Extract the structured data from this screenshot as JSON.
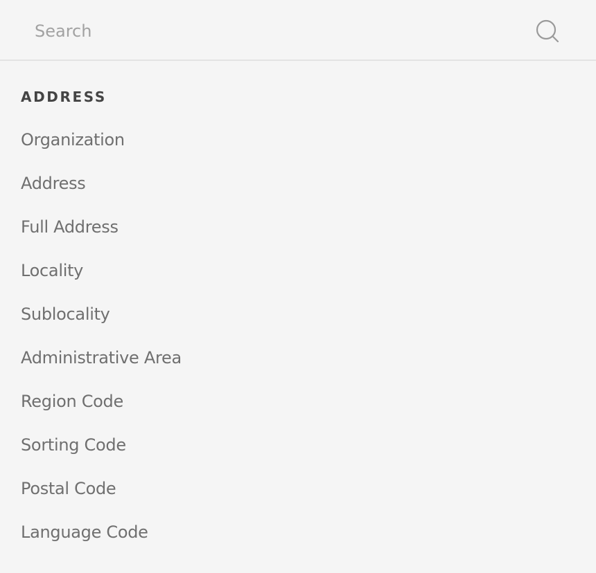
{
  "search": {
    "placeholder": "Search",
    "value": "",
    "icon": "search-icon"
  },
  "section": {
    "title": "ADDRESS",
    "items": [
      {
        "label": "Organization"
      },
      {
        "label": "Address"
      },
      {
        "label": "Full Address"
      },
      {
        "label": "Locality"
      },
      {
        "label": "Sublocality"
      },
      {
        "label": "Administrative Area"
      },
      {
        "label": "Region Code"
      },
      {
        "label": "Sorting Code"
      },
      {
        "label": "Postal Code"
      },
      {
        "label": "Language Code"
      }
    ]
  },
  "colors": {
    "background": "#f5f5f5",
    "item_text": "#6f6f6f",
    "title_text": "#444444",
    "divider": "#e3e3e3"
  }
}
